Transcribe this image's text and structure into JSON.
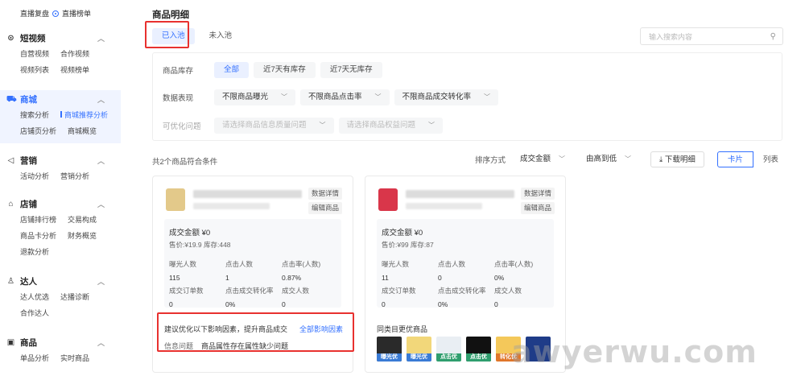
{
  "sidebar": {
    "top_items": [
      "直播复盘",
      "直播榜单"
    ],
    "sections": [
      {
        "title": "短视频",
        "icon": "circle-play-icon",
        "rows": [
          [
            "自营视频",
            "合作视频"
          ],
          [
            "视频列表",
            "视频榜单"
          ]
        ]
      },
      {
        "title": "商城",
        "icon": "cart-icon",
        "rows": [
          [
            "搜索分析",
            "商城推荐分析"
          ],
          [
            "店铺页分析",
            "商城概览"
          ]
        ],
        "active": true,
        "current": "商城推荐分析"
      },
      {
        "title": "营销",
        "icon": "megaphone-icon",
        "rows": [
          [
            "活动分析",
            "营销分析"
          ]
        ]
      },
      {
        "title": "店铺",
        "icon": "store-icon",
        "rows": [
          [
            "店铺排行榜",
            "交易构成"
          ],
          [
            "商品卡分析",
            "财务概览"
          ],
          [
            "退款分析"
          ]
        ]
      },
      {
        "title": "达人",
        "icon": "person-icon",
        "rows": [
          [
            "达人优选",
            "达播诊断"
          ],
          [
            "合作达人"
          ]
        ]
      },
      {
        "title": "商品",
        "icon": "box-icon",
        "rows": [
          [
            "单品分析",
            "实时商品"
          ]
        ]
      }
    ]
  },
  "page": {
    "title": "商品明细",
    "tabs": [
      "已入池",
      "未入池"
    ],
    "search_placeholder": "输入搜索内容"
  },
  "filters": {
    "stock": {
      "label": "商品库存",
      "options": [
        "全部",
        "近7天有库存",
        "近7天无库存"
      ],
      "selected": "全部"
    },
    "performance": {
      "label": "数据表现",
      "dropdowns": [
        "不限商品曝光",
        "不限商品点击率",
        "不限商品成交转化率"
      ]
    },
    "optimize": {
      "label": "可优化问题",
      "dropdowns": [
        "请选择商品信息质量问题",
        "请选择商品权益问题"
      ]
    }
  },
  "results": {
    "count_text": "共2个商品符合条件",
    "sort_label": "排序方式",
    "sort_field": "成交金额",
    "sort_order": "由高到低",
    "download": "下载明细",
    "view_card": "卡片",
    "view_list": "列表"
  },
  "cards": [
    {
      "thumb_color": "#e3c98a",
      "btn_detail": "数据详情",
      "btn_edit": "编辑商品",
      "gmv": "成交金额 ¥0",
      "price_stock": "售价:¥19.9  库存:448",
      "metrics": [
        {
          "label": "曝光人数",
          "value": "115"
        },
        {
          "label": "点击人数",
          "value": "1"
        },
        {
          "label": "点击率(人数)",
          "value": "0.87%"
        },
        {
          "label": "成交订单数",
          "value": "0"
        },
        {
          "label": "点击成交转化率",
          "value": "0%"
        },
        {
          "label": "成交人数",
          "value": "0"
        }
      ],
      "suggest_title": "建议优化以下影响因素，提升商品成交",
      "suggest_link": "全部影响因素",
      "suggest_key": "信息问题",
      "suggest_value": "商品属性存在属性缺少问题"
    },
    {
      "thumb_color": "#d9364a",
      "btn_detail": "数据详情",
      "btn_edit": "编辑商品",
      "gmv": "成交金额 ¥0",
      "price_stock": "售价:¥99  库存:87",
      "metrics": [
        {
          "label": "曝光人数",
          "value": "11"
        },
        {
          "label": "点击人数",
          "value": "0"
        },
        {
          "label": "点击率(人数)",
          "value": "0%"
        },
        {
          "label": "成交订单数",
          "value": "0"
        },
        {
          "label": "点击成交转化率",
          "value": "0%"
        },
        {
          "label": "成交人数",
          "value": "0"
        }
      ],
      "peer_title": "同类目更优商品",
      "peers": [
        {
          "bg": "#2a2a2a",
          "tag": "曝光优",
          "tag_color": "#3a7bd5"
        },
        {
          "bg": "#f2d77a",
          "tag": "曝光优",
          "tag_color": "#3a7bd5"
        },
        {
          "bg": "#e9eef3",
          "tag": "点击优",
          "tag_color": "#2f9e6e"
        },
        {
          "bg": "#111111",
          "tag": "点击优",
          "tag_color": "#2f9e6e"
        },
        {
          "bg": "#f4c85a",
          "tag": "转化优",
          "tag_color": "#e0762a"
        },
        {
          "bg": "#1f3c88",
          "tag": "",
          "tag_color": "#1f3c88"
        }
      ]
    }
  ],
  "watermark": "awyerwu.com",
  "colors": {
    "accent": "#3370ff",
    "highlight": "#e8312f"
  }
}
